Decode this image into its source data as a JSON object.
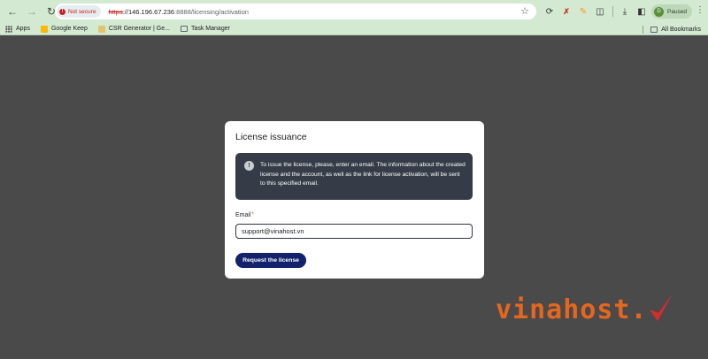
{
  "browser": {
    "security_label": "Not secure",
    "url_scheme": "https",
    "url_host": "://146.196.67.236",
    "url_port": ":8888",
    "url_path": "/licensing/activation",
    "profile_label": "Paused",
    "profile_initial": "D"
  },
  "bookmarks": {
    "items": [
      {
        "label": "Apps",
        "icon": "apps-icon"
      },
      {
        "label": "Google Keep",
        "icon": "keep-icon"
      },
      {
        "label": "CSR Generator | Ge...",
        "icon": "csr-icon"
      },
      {
        "label": "Task Manager",
        "icon": "folder-icon"
      }
    ],
    "all_label": "All Bookmarks"
  },
  "dialog": {
    "title": "License issuance",
    "info_text": "To issue the license, please, enter an email. The information about the created license and the account, as well as the link for license activation, will be sent to this specified email.",
    "email_label": "Email",
    "required_mark": "*",
    "email_value": "support@vinahost.vn",
    "submit_label": "Request the license"
  },
  "brand": {
    "text": "vinahost."
  },
  "colors": {
    "chrome_bg": "#d3e9d1",
    "page_bg": "#4a4a4a",
    "info_bg": "#363c47",
    "button_bg": "#14216b",
    "brand_orange": "#e5671f",
    "brand_red": "#d92b2b"
  }
}
